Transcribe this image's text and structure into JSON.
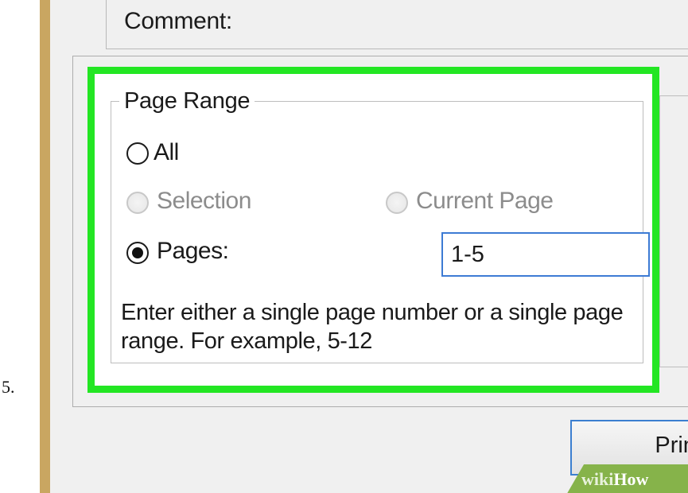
{
  "step": {
    "number": "5."
  },
  "dialog": {
    "comment_label": "Comment:",
    "page_range": {
      "legend": "Page Range",
      "options": [
        {
          "label": "All",
          "selected": false,
          "enabled": true
        },
        {
          "label": "Selection",
          "selected": false,
          "enabled": false
        },
        {
          "label": "Current Page",
          "selected": false,
          "enabled": false
        },
        {
          "label": "Pages:",
          "selected": true,
          "enabled": true
        }
      ],
      "pages_value": "1-5",
      "hint": "Enter either a single page number or a single page range.  For example, 5-12"
    },
    "print_button": "Print"
  },
  "watermark": {
    "wiki": "wiki",
    "how": "How"
  },
  "colors": {
    "highlight": "#23e623",
    "input_border": "#3d7bd4",
    "frame": "#c9a661",
    "dialog_bg": "#f0f0f0"
  },
  "icons": [
    "radio-unselected-icon",
    "radio-disabled-icon",
    "radio-selected-icon"
  ]
}
